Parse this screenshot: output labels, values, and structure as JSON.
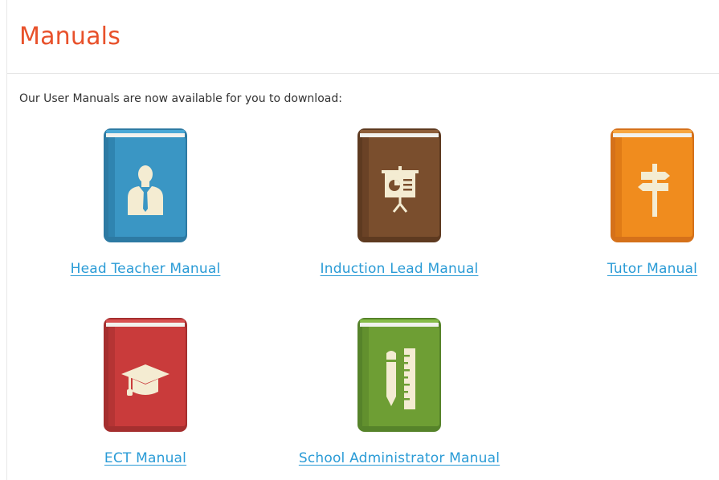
{
  "page": {
    "title": "Manuals",
    "intro": "Our User Manuals are now available for you to download:",
    "accent_color": "#e8512b",
    "link_color": "#2a9bd6"
  },
  "manuals": [
    {
      "label": "Head Teacher Manual",
      "icon": "teacher-person-icon",
      "color": "#3a96c4"
    },
    {
      "label": "Induction Lead Manual",
      "icon": "presentation-board-icon",
      "color": "#7a4e2d"
    },
    {
      "label": "Tutor Manual",
      "icon": "signpost-icon",
      "color": "#f08c1e"
    },
    {
      "label": "ECT Manual",
      "icon": "graduation-cap-icon",
      "color": "#c93b3b"
    },
    {
      "label": "School Administrator Manual",
      "icon": "pencil-ruler-icon",
      "color": "#6e9e34"
    }
  ]
}
